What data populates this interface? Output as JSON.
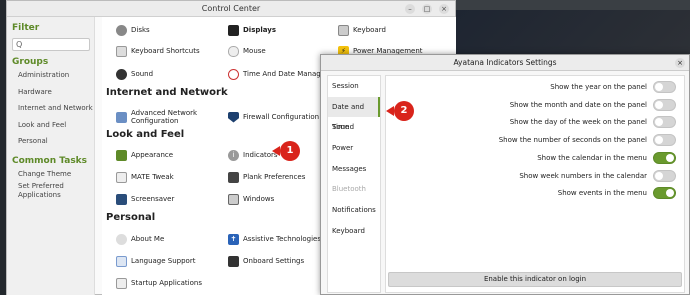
{
  "control_center": {
    "title": "Control Center",
    "window_buttons": [
      "–",
      "□",
      "×"
    ],
    "sidebar": {
      "filter_heading": "Filter",
      "search_placeholder": "Q",
      "groups_heading": "Groups",
      "groups": [
        "Administration",
        "Hardware",
        "Internet and Network",
        "Look and Feel",
        "Personal"
      ],
      "tasks_heading": "Common Tasks",
      "tasks": [
        "Change Theme",
        "Set Preferred\nApplications"
      ]
    },
    "sections": {
      "internet": "Internet and Network",
      "look": "Look and Feel",
      "personal": "Personal"
    },
    "items": {
      "disks": "Disks",
      "displays": "Displays",
      "keyboard": "Keyboard",
      "shortcuts": "Keyboard Shortcuts",
      "mouse": "Mouse",
      "power_mgmt": "Power Management",
      "sound": "Sound",
      "time_date": "Time And Date Manager",
      "adv_net": "Advanced Network\nConfiguration",
      "firewall": "Firewall Configuration",
      "appearance": "Appearance",
      "indicators": "Indicators",
      "mate_tweak": "MATE Tweak",
      "plank": "Plank Preferences",
      "screensaver": "Screensaver",
      "windows": "Windows",
      "about_me": "About Me",
      "assistive": "Assistive Technologies",
      "language": "Language Support",
      "onboard": "Onboard Settings",
      "startup": "Startup Applications"
    }
  },
  "dialog": {
    "title": "Ayatana Indicators Settings",
    "close": "×",
    "nav": [
      "Session",
      "Date and Time",
      "Sound",
      "Power",
      "Messages",
      "Bluetooth",
      "Notifications",
      "Keyboard"
    ],
    "active_nav": "Date and Time",
    "options": [
      {
        "label": "Show the year on the panel",
        "on": false
      },
      {
        "label": "Show the month and date on the panel",
        "on": false
      },
      {
        "label": "Show the day of the week on the panel",
        "on": false
      },
      {
        "label": "Show the number of seconds on the panel",
        "on": false
      },
      {
        "label": "Show the calendar in the menu",
        "on": true
      },
      {
        "label": "Show week numbers in the calendar",
        "on": false
      },
      {
        "label": "Show events in the menu",
        "on": true
      }
    ],
    "enable_button": "Enable this indicator on login"
  },
  "annotations": {
    "badge1": "1",
    "badge2": "2"
  },
  "colors": {
    "accent": "#6a9a2e",
    "badge": "#d9241b"
  }
}
